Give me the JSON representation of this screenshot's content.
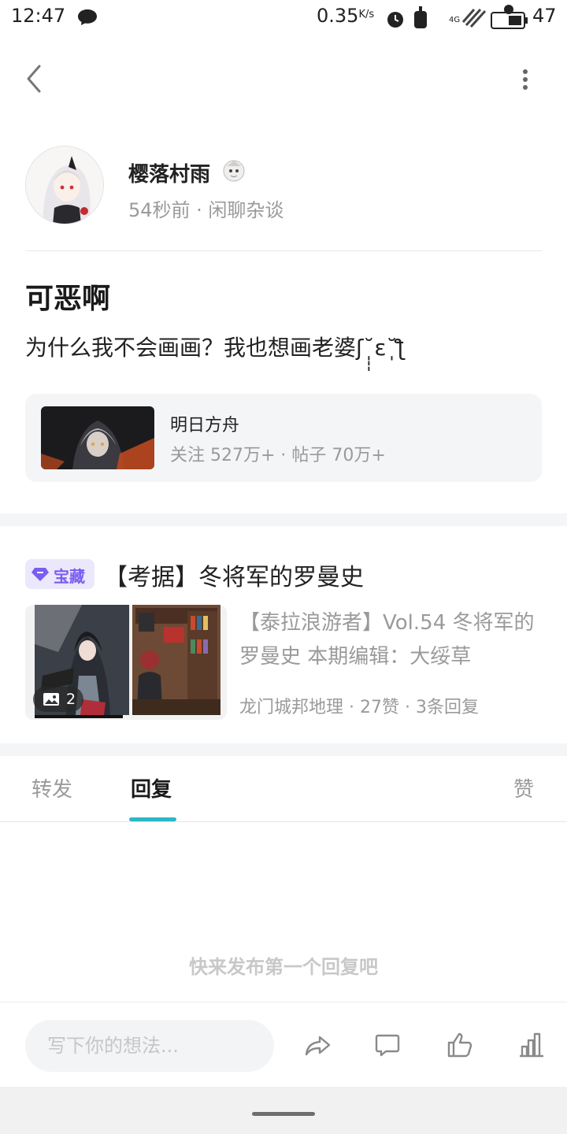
{
  "status_bar": {
    "time": "12:47",
    "speed_value": "0.35",
    "speed_unit": "K/s",
    "network": "4G",
    "battery": "47"
  },
  "header": {
    "back_icon": "chevron-left-icon",
    "more_icon": "more-vertical-icon"
  },
  "author": {
    "name": "樱落村雨",
    "meta": "54秒前 · 闲聊杂谈"
  },
  "post": {
    "title": "可恶啊",
    "body": "为什么我不会画画？我也想画老婆ʃ˘̩̩̩ε˘̩ƪ"
  },
  "forum": {
    "name": "明日方舟",
    "stats": "关注 527万+ · 帖子 70万+"
  },
  "related": {
    "badge": "宝藏",
    "title": "【考据】冬将军的罗曼史",
    "image_count": "2",
    "description": "【泰拉浪游者】Vol.54 冬将军的罗曼史 本期编辑：大绥草",
    "meta": "龙门城邦地理 · 27赞 · 3条回复"
  },
  "tabs": [
    {
      "label": "转发",
      "active": false
    },
    {
      "label": "回复",
      "active": true
    },
    {
      "label": "赞",
      "active": false
    }
  ],
  "empty_state": "快来发布第一个回复吧",
  "bottom_bar": {
    "input_placeholder": "写下你的想法...",
    "icons": [
      "share-icon",
      "comment-icon",
      "like-icon",
      "stats-icon"
    ]
  },
  "colors": {
    "accent": "#2bb7c4",
    "treasure": "#7a5cf0",
    "muted": "#9a9a9a"
  }
}
